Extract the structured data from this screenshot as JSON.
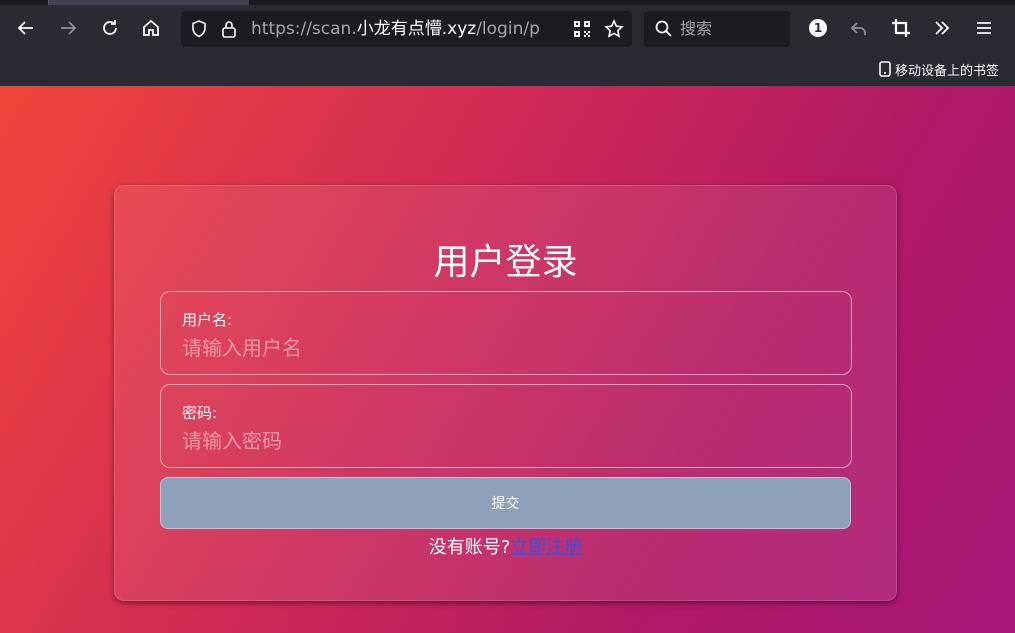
{
  "browser": {
    "url_prefix": "https://scan.",
    "url_domain": "小龙有点懵.xyz",
    "url_path": "/login/p",
    "search_placeholder": "搜索",
    "extension_badge": "1",
    "bookmark_label": "移动设备上的书签"
  },
  "login": {
    "title": "用户登录",
    "username_label": "用户名:",
    "username_placeholder": "请输入用户名",
    "password_label": "密码:",
    "password_placeholder": "请输入密码",
    "submit_label": "提交",
    "no_account_text": "没有账号?",
    "register_link": "立即注册"
  },
  "colors": {
    "chrome_bg": "#2b2a33",
    "urlbar_bg": "#1c1b22",
    "button_bg": "#8fa0ba",
    "link_color": "#3b4fe0",
    "gradient_start": "#f0453b",
    "gradient_end": "#a8177a"
  }
}
